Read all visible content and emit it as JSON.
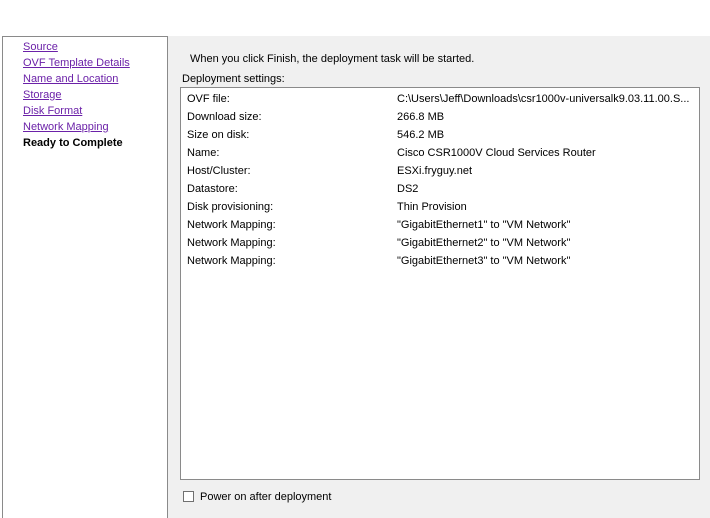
{
  "nav": {
    "items": [
      {
        "label": "Source"
      },
      {
        "label": "OVF Template Details"
      },
      {
        "label": "Name and Location"
      },
      {
        "label": "Storage"
      },
      {
        "label": "Disk Format"
      },
      {
        "label": "Network Mapping"
      },
      {
        "label": "Ready to Complete"
      }
    ]
  },
  "main": {
    "intro_text": "When you click Finish, the deployment task will be started.",
    "settings_label": "Deployment settings:",
    "settings": [
      {
        "key": "OVF file:",
        "value": "C:\\Users\\Jeff\\Downloads\\csr1000v-universalk9.03.11.00.S..."
      },
      {
        "key": "Download size:",
        "value": "266.8 MB"
      },
      {
        "key": "Size on disk:",
        "value": "546.2 MB"
      },
      {
        "key": "Name:",
        "value": "Cisco CSR1000V Cloud Services Router"
      },
      {
        "key": "Host/Cluster:",
        "value": "ESXi.fryguy.net"
      },
      {
        "key": "Datastore:",
        "value": "DS2"
      },
      {
        "key": "Disk provisioning:",
        "value": "Thin Provision"
      },
      {
        "key": "Network Mapping:",
        "value": "\"GigabitEthernet1\" to \"VM Network\""
      },
      {
        "key": "Network Mapping:",
        "value": "\"GigabitEthernet2\" to \"VM Network\""
      },
      {
        "key": "Network Mapping:",
        "value": "\"GigabitEthernet3\" to \"VM Network\""
      }
    ],
    "power_on_label": "Power on after deployment",
    "power_on_checked": false
  }
}
